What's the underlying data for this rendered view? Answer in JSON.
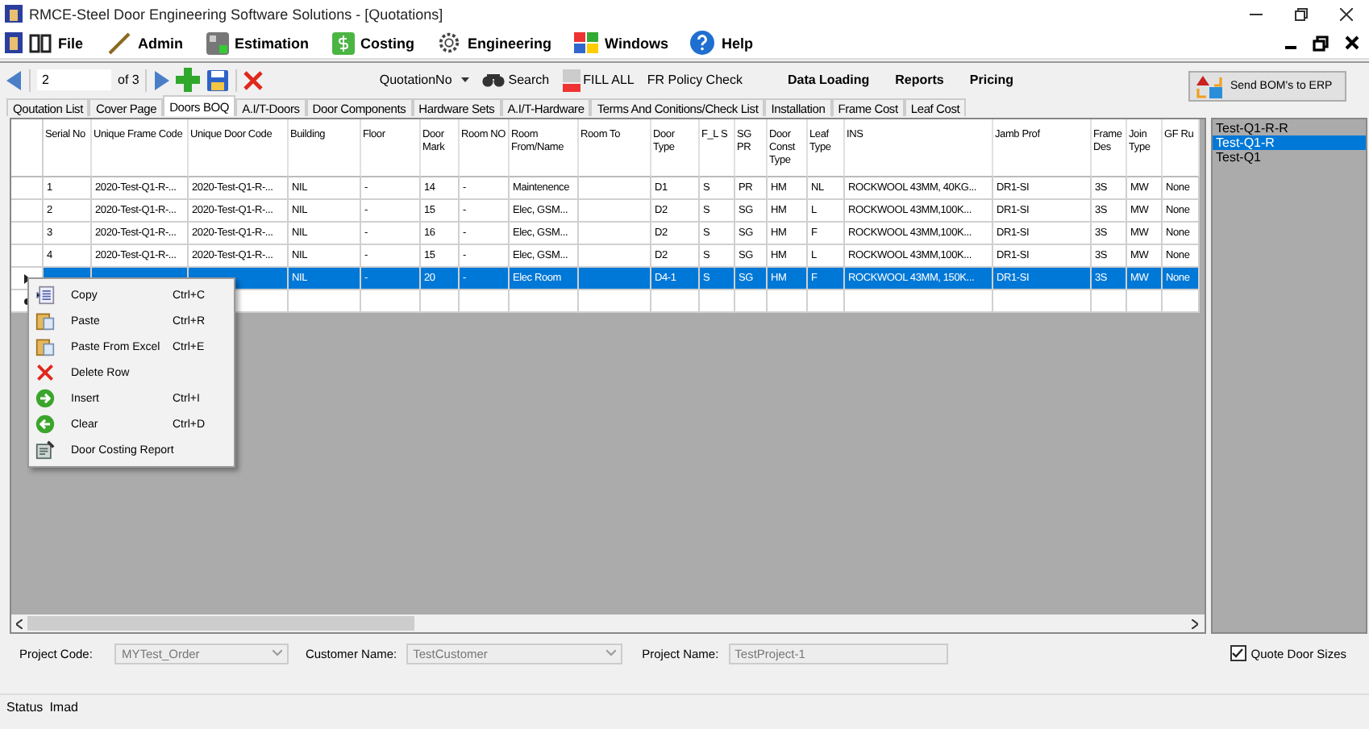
{
  "window": {
    "title": "RMCE-Steel Door Engineering Software Solutions - [Quotations]"
  },
  "menu": [
    {
      "label": "File"
    },
    {
      "label": "Admin"
    },
    {
      "label": "Estimation"
    },
    {
      "label": "Costing"
    },
    {
      "label": "Engineering"
    },
    {
      "label": "Windows"
    },
    {
      "label": "Help"
    }
  ],
  "toolbar": {
    "record": "2",
    "record_total": "of 3",
    "search_field": "QuotationNo",
    "search": "Search",
    "fill_all": "FILL ALL",
    "fr_policy": "FR Policy Check",
    "menus": [
      "Data Loading",
      "Reports",
      "Pricing"
    ],
    "send_button": "Send BOM's to ERP"
  },
  "tabs": [
    {
      "label": "Qoutation List",
      "selected": false
    },
    {
      "label": "Cover Page",
      "selected": false
    },
    {
      "label": "Doors BOQ",
      "selected": true
    },
    {
      "label": "A.I/T-Doors",
      "selected": false
    },
    {
      "label": "Door Components",
      "selected": false
    },
    {
      "label": "Hardware Sets",
      "selected": false
    },
    {
      "label": "A.I/T-Hardware",
      "selected": false
    },
    {
      "label": "Terms And Conitions/Check List",
      "selected": false
    },
    {
      "label": "Installation",
      "selected": false
    },
    {
      "label": "Frame Cost",
      "selected": false
    },
    {
      "label": "Leaf Cost",
      "selected": false
    }
  ],
  "table": {
    "columns": [
      "Serial No",
      "Unique Frame Code",
      "Unique Door Code",
      "Building",
      "Floor",
      "Door Mark",
      "Room NO",
      "Room From/Name",
      "Room To",
      "Door Type",
      "F_L S",
      "SG PR",
      "Door Const Type",
      "Leaf Type",
      "INS",
      "Jamb Prof",
      "Frame Des",
      "Join Type",
      "GF Ru"
    ],
    "rows": [
      {
        "selected": false,
        "cells": [
          "1",
          "2020-Test-Q1-R-...",
          "2020-Test-Q1-R-...",
          "NIL",
          "-",
          "14",
          "-",
          "Maintenence",
          "",
          "D1",
          "S",
          "PR",
          "HM",
          "NL",
          "ROCKWOOL 43MM, 40KG...",
          "DR1-SI",
          "3S",
          "MW",
          "None"
        ]
      },
      {
        "selected": false,
        "cells": [
          "2",
          "2020-Test-Q1-R-...",
          "2020-Test-Q1-R-...",
          "NIL",
          "-",
          "15",
          "-",
          "Elec, GSM...",
          "",
          "D2",
          "S",
          "SG",
          "HM",
          "L",
          "ROCKWOOL 43MM,100K...",
          "DR1-SI",
          "3S",
          "MW",
          "None"
        ]
      },
      {
        "selected": false,
        "cells": [
          "3",
          "2020-Test-Q1-R-...",
          "2020-Test-Q1-R-...",
          "NIL",
          "-",
          "16",
          "-",
          "Elec, GSM...",
          "",
          "D2",
          "S",
          "SG",
          "HM",
          "F",
          "ROCKWOOL 43MM,100K...",
          "DR1-SI",
          "3S",
          "MW",
          "None"
        ]
      },
      {
        "selected": false,
        "cells": [
          "4",
          "2020-Test-Q1-R-...",
          "2020-Test-Q1-R-...",
          "NIL",
          "-",
          "15",
          "-",
          "Elec, GSM...",
          "",
          "D2",
          "S",
          "SG",
          "HM",
          "L",
          "ROCKWOOL 43MM,100K...",
          "DR1-SI",
          "3S",
          "MW",
          "None"
        ]
      },
      {
        "selected": true,
        "cells": [
          "",
          "",
          "",
          "NIL",
          "-",
          "20",
          "-",
          "Elec Room",
          "",
          "D4-1",
          "S",
          "SG",
          "HM",
          "F",
          "ROCKWOOL 43MM, 150K...",
          "DR1-SI",
          "3S",
          "MW",
          "None"
        ]
      }
    ]
  },
  "context_menu": [
    {
      "kind": "copy",
      "label": "Copy",
      "shortcut": "Ctrl+C"
    },
    {
      "kind": "paste",
      "label": "Paste",
      "shortcut": "Ctrl+R"
    },
    {
      "kind": "paste",
      "label": "Paste From Excel",
      "shortcut": "Ctrl+E"
    },
    {
      "kind": "delete",
      "label": "Delete Row"
    },
    {
      "kind": "insert",
      "label": "Insert",
      "shortcut": "Ctrl+I"
    },
    {
      "kind": "clear",
      "label": "Clear",
      "shortcut": "Ctrl+D"
    },
    {
      "kind": "report",
      "label": "Door Costing Report"
    }
  ],
  "revisions": [
    {
      "label": "Test-Q1-R-R",
      "selected": false
    },
    {
      "label": "Test-Q1-R",
      "selected": true
    },
    {
      "label": "Test-Q1",
      "selected": false
    }
  ],
  "footer": {
    "project_code_label": "Project Code:",
    "project_code": "MYTest_Order",
    "customer_name_label": "Customer Name:",
    "customer_name": "TestCustomer",
    "project_name_label": "Project Name:",
    "project_name": "TestProject-1",
    "quote_door_sizes": {
      "label": "Quote Door Sizes",
      "checked": true
    }
  },
  "status_bar": {
    "label": "Status",
    "user": "Imad"
  }
}
